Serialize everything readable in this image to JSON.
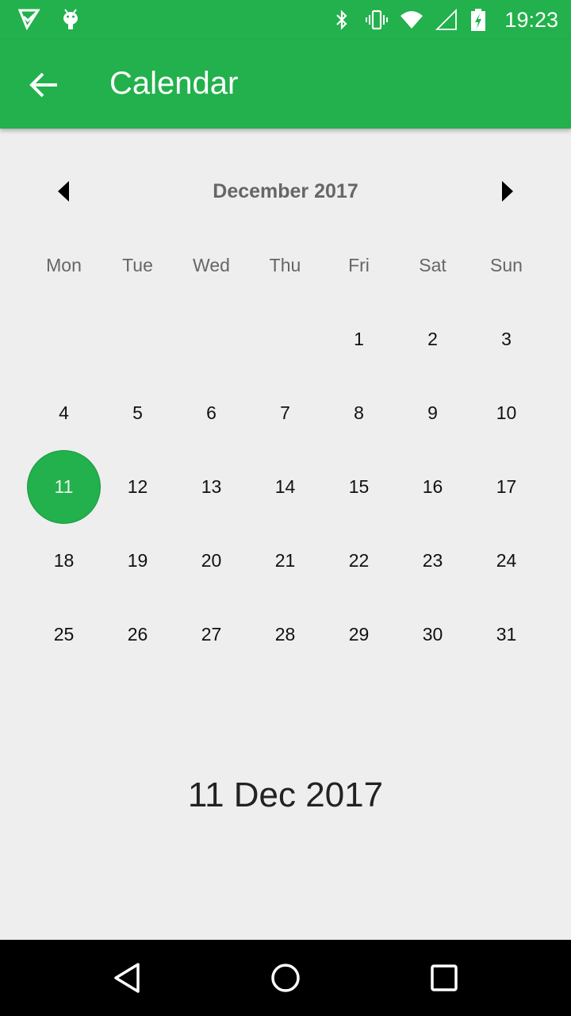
{
  "status_bar": {
    "time": "19:23",
    "left_icons": [
      "check-notification-icon",
      "android-debug-icon"
    ],
    "right_icons": [
      "bluetooth-icon",
      "vibrate-icon",
      "wifi-icon",
      "signal-icon",
      "battery-charging-icon"
    ]
  },
  "app_bar": {
    "title": "Calendar",
    "back_icon": "arrow-back-icon"
  },
  "calendar": {
    "month_title": "December 2017",
    "prev_icon": "triangle-left-icon",
    "next_icon": "triangle-right-icon",
    "weekdays": [
      "Mon",
      "Tue",
      "Wed",
      "Thu",
      "Fri",
      "Sat",
      "Sun"
    ],
    "leading_blanks": 4,
    "days": [
      "1",
      "2",
      "3",
      "4",
      "5",
      "6",
      "7",
      "8",
      "9",
      "10",
      "11",
      "12",
      "13",
      "14",
      "15",
      "16",
      "17",
      "18",
      "19",
      "20",
      "21",
      "22",
      "23",
      "24",
      "25",
      "26",
      "27",
      "28",
      "29",
      "30",
      "31"
    ],
    "selected_day": "11"
  },
  "selected_date_text": "11 Dec 2017",
  "nav_bar": {
    "icons": [
      "back-triangle-icon",
      "home-circle-icon",
      "recents-square-icon"
    ]
  },
  "colors": {
    "primary": "#22b14c",
    "background": "#eeeeee"
  }
}
